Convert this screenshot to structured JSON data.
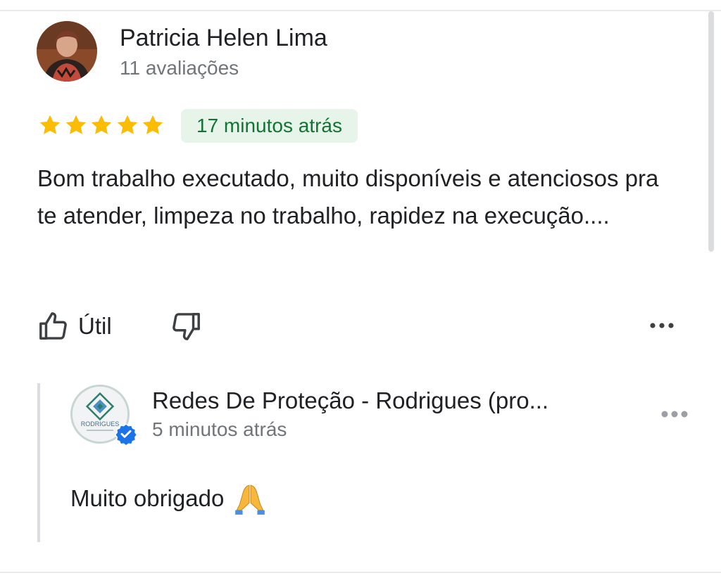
{
  "review": {
    "reviewer_name": "Patricia Helen Lima",
    "review_count": "11 avaliações",
    "rating": 5,
    "rating_max": 5,
    "time_ago": "17 minutos atrás",
    "text": "Bom trabalho executado, muito disponíveis e atenciosos pra te atender, limpeza no trabalho, rapidez na execução....",
    "actions": {
      "useful_label": "Útil",
      "useful_icon": "thumbs-up-icon",
      "not_useful_icon": "thumbs-down-icon",
      "more_icon": "more-horizontal-icon"
    }
  },
  "owner_reply": {
    "owner_name": "Redes De Proteção - Rodrigues (pro...",
    "time_ago": "5 minutos atrás",
    "text": "Muito obrigado",
    "emoji_icon": "praying-hands-icon",
    "verified_icon": "verified-badge-icon",
    "logo_text": "RODRIGUES",
    "more_icon": "more-horizontal-icon"
  },
  "colors": {
    "star": "#fbbc04",
    "time_chip_bg": "#e6f4ea",
    "time_chip_text": "#137333",
    "secondary_text": "#70757a",
    "verified": "#1a73e8"
  }
}
